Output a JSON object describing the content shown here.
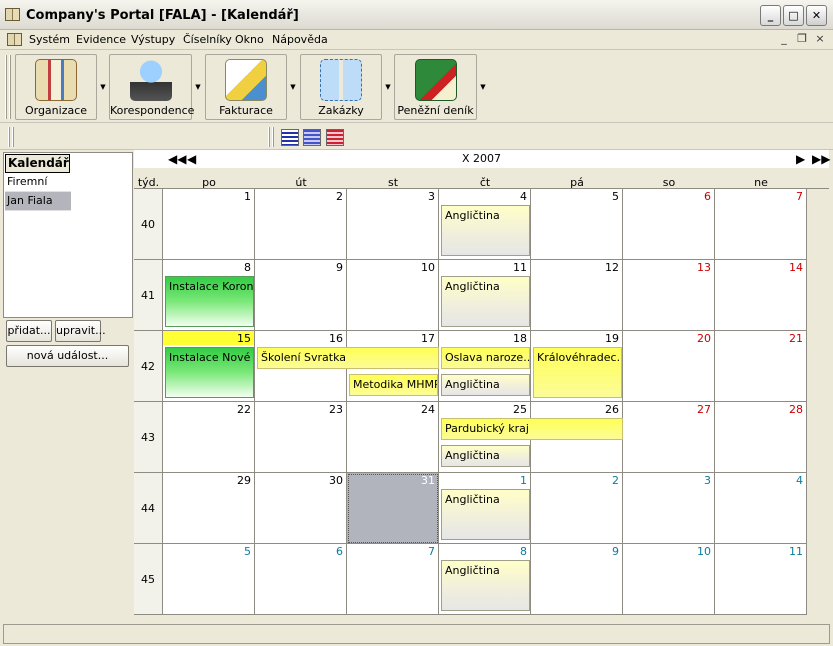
{
  "window": {
    "title": "Company's Portal [FALA] - [Kalendář]"
  },
  "menu": {
    "items": [
      "Systém",
      "Evidence",
      "Výstupy",
      "Číselníky",
      "Okno",
      "Nápověda"
    ]
  },
  "toolbar": {
    "buttons": [
      {
        "label": "Organizace",
        "icon": "organizer-icon"
      },
      {
        "label": "Korespondence",
        "icon": "magic-hat-icon"
      },
      {
        "label": "Fakturace",
        "icon": "invoice-icon"
      },
      {
        "label": "Zakázky",
        "icon": "orders-icon"
      },
      {
        "label": "Peněžní deník",
        "icon": "money-book-icon"
      }
    ]
  },
  "view_icons": [
    "blue-flag-icon",
    "blue-stripes-icon",
    "red-stripes-icon"
  ],
  "left": {
    "header": "Kalendář",
    "calendars": [
      "Firemní",
      "Jan Fiala"
    ],
    "add_label": "přidat...",
    "edit_label": "upravit...",
    "new_event_label": "nová událost..."
  },
  "calendar": {
    "month": "X 2007",
    "week_header": "týd.",
    "days": [
      "po",
      "út",
      "st",
      "čt",
      "pá",
      "so",
      "ne"
    ],
    "weeks": [
      {
        "number": "40",
        "dates": [
          "1",
          "2",
          "3",
          "4",
          "5",
          "6",
          "7"
        ]
      },
      {
        "number": "41",
        "dates": [
          "8",
          "9",
          "10",
          "11",
          "12",
          "13",
          "14"
        ]
      },
      {
        "number": "42",
        "dates": [
          "15",
          "16",
          "17",
          "18",
          "19",
          "20",
          "21"
        ]
      },
      {
        "number": "43",
        "dates": [
          "22",
          "23",
          "24",
          "25",
          "26",
          "27",
          "28"
        ]
      },
      {
        "number": "44",
        "dates": [
          "29",
          "30",
          "31",
          "1",
          "2",
          "3",
          "4"
        ]
      },
      {
        "number": "45",
        "dates": [
          "5",
          "6",
          "7",
          "8",
          "9",
          "10",
          "11"
        ]
      }
    ],
    "events": {
      "angl1": "Angličtina",
      "angl2": "Angličtina",
      "instalace_koron": "Instalace Koron...",
      "instalace_nove": "Instalace Nové ...",
      "skoleni": "Školení Svratka",
      "metodika": "Metodika MHMP",
      "oslava": "Oslava naroze...",
      "angl3": "Angličtina",
      "kralove": "Královéhradec...",
      "pardubicky": "Pardubický kraj",
      "angl4": "Angličtina",
      "angl5": "Angličtina",
      "angl6": "Angličtina"
    }
  },
  "colors": {
    "weekend": "#cc0000",
    "next_month": "#0a7c9a",
    "today": "#b2b4bd",
    "highlight": "#ffff33"
  }
}
